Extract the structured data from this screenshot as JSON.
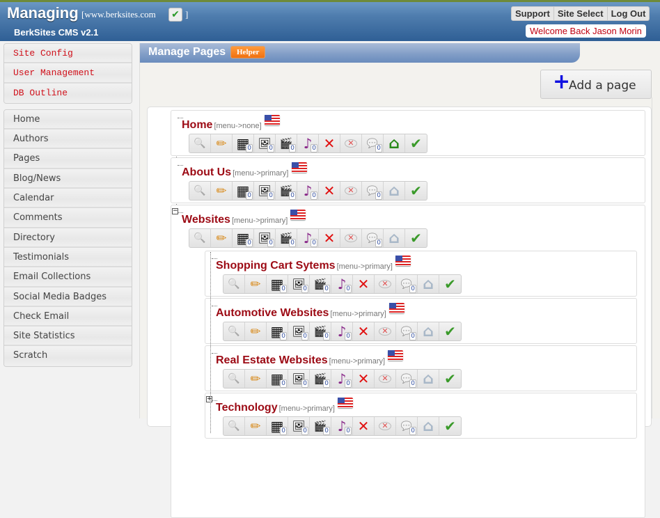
{
  "header": {
    "app_title": "Managing",
    "site_url": "[www.berksites.com",
    "site_close": "]",
    "cms_version": "BerkSites CMS v2.1",
    "nav": [
      {
        "label": "Support"
      },
      {
        "label": "Site Select"
      },
      {
        "label": "Log Out"
      }
    ],
    "welcome": "Welcome Back Jason Morin"
  },
  "sidebar": {
    "admin_items": [
      {
        "label": "Site Config"
      },
      {
        "label": "User Management"
      },
      {
        "label": "DB Outline"
      }
    ],
    "items": [
      {
        "label": "Home"
      },
      {
        "label": "Authors"
      },
      {
        "label": "Pages"
      },
      {
        "label": "Blog/News"
      },
      {
        "label": "Calendar"
      },
      {
        "label": "Comments"
      },
      {
        "label": "Directory"
      },
      {
        "label": "Testimonials"
      },
      {
        "label": "Email Collections"
      },
      {
        "label": "Social Media Badges"
      },
      {
        "label": "Check Email"
      },
      {
        "label": "Site Statistics"
      },
      {
        "label": "Scratch"
      }
    ]
  },
  "main": {
    "title": "Manage Pages",
    "helper_label": "Helper",
    "add_page_label": "Add a page",
    "add_page_icon": "plus-icon"
  },
  "toolbar_icons": [
    "view-icon",
    "edit-icon",
    "grid-icon",
    "image-icon",
    "video-icon",
    "music-icon",
    "delete-icon",
    "remove-comment-icon",
    "comments-icon",
    "home-icon",
    "approve-icon"
  ],
  "pages": [
    {
      "name": "Home",
      "menu": "[menu->none]",
      "counts": {
        "grid": "0",
        "image": "0",
        "video": "0",
        "music": "0",
        "comments": "0"
      },
      "is_home": true
    },
    {
      "name": "About Us",
      "menu": "[menu->primary]",
      "counts": {
        "grid": "0",
        "image": "0",
        "video": "0",
        "music": "0",
        "comments": "0"
      },
      "is_home": false
    },
    {
      "name": "Websites",
      "menu": "[menu->primary]",
      "counts": {
        "grid": "0",
        "image": "0",
        "video": "0",
        "music": "0",
        "comments": "0"
      },
      "is_home": false,
      "expander": "−"
    },
    {
      "name": "Shopping Cart Sytems",
      "menu": "[menu->primary]",
      "counts": {
        "grid": "0",
        "image": "0",
        "video": "0",
        "music": "0",
        "comments": "0"
      },
      "is_home": false
    },
    {
      "name": "Automotive Websites",
      "menu": "[menu->primary]",
      "counts": {
        "grid": "0",
        "image": "0",
        "video": "0",
        "music": "0",
        "comments": "0"
      },
      "is_home": false
    },
    {
      "name": "Real Estate Websites",
      "menu": "[menu->primary]",
      "counts": {
        "grid": "0",
        "image": "0",
        "video": "0",
        "music": "0",
        "comments": "0"
      },
      "is_home": false
    },
    {
      "name": "Technology",
      "menu": "[menu->primary]",
      "counts": {
        "grid": "0",
        "image": "0",
        "video": "0",
        "music": "0",
        "comments": "0"
      },
      "is_home": false,
      "expander": "+"
    }
  ],
  "colors": {
    "brand_blue": "#2f5f95",
    "page_title_red": "#9c0a14",
    "accent_orange": "#f07010",
    "admin_link_red": "#d0101a"
  }
}
